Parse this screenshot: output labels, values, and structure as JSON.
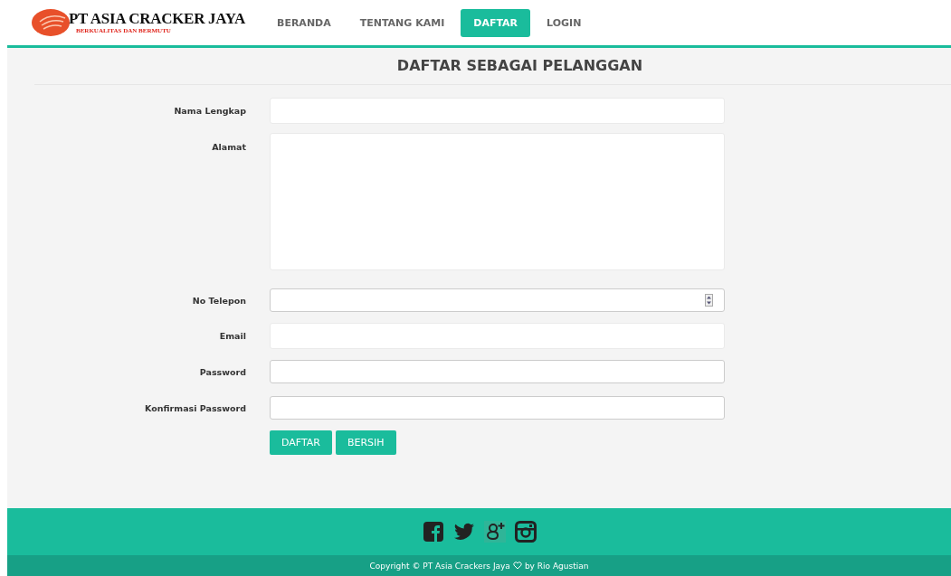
{
  "brand": {
    "name": "PT ASIA CRACKER JAYA",
    "tagline": "BERKUALITAS DAN BERMUTU"
  },
  "nav": [
    {
      "label": "BERANDA",
      "selected": false
    },
    {
      "label": "TENTANG KAMI",
      "selected": false
    },
    {
      "label": "DAFTAR",
      "selected": true
    },
    {
      "label": "LOGIN",
      "selected": false
    }
  ],
  "title": "DAFTAR SEBAGAI PELANGGAN",
  "fields": [
    {
      "label": "Nama Lengkap",
      "kind": "text"
    },
    {
      "label": "Alamat",
      "kind": "textarea"
    },
    {
      "label": "No Telepon",
      "kind": "number"
    },
    {
      "label": "Email",
      "kind": "email"
    },
    {
      "label": "Password",
      "kind": "password"
    },
    {
      "label": "Konfirmasi Password",
      "kind": "password"
    }
  ],
  "buttons": [
    "DAFTAR",
    "BERSIH"
  ],
  "footer": {
    "copyright_before": "Copyright © PT Asia Crackers Jaya",
    "copyright_after": "by Rio Agustian"
  }
}
